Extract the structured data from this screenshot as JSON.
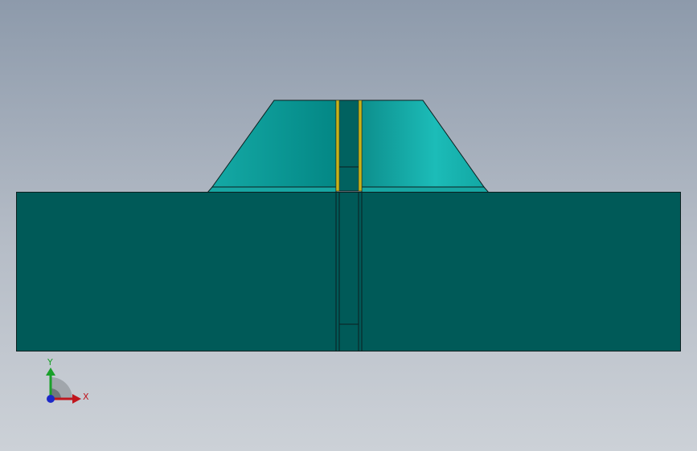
{
  "viewport": {
    "background_top": "#8d9aab",
    "background_bottom": "#ccd1d7"
  },
  "model": {
    "body_color": "#005a58",
    "edge_color": "#0b1f1f",
    "chamfer_color_light": "#1ab9b5",
    "chamfer_color_dark": "#018a88",
    "slot_highlight_color": "#c8b21c"
  },
  "triad": {
    "x_label": "X",
    "y_label": "Y",
    "x_color": "#c0161e",
    "y_color": "#1aa02a",
    "z_color": "#1c28c8"
  }
}
